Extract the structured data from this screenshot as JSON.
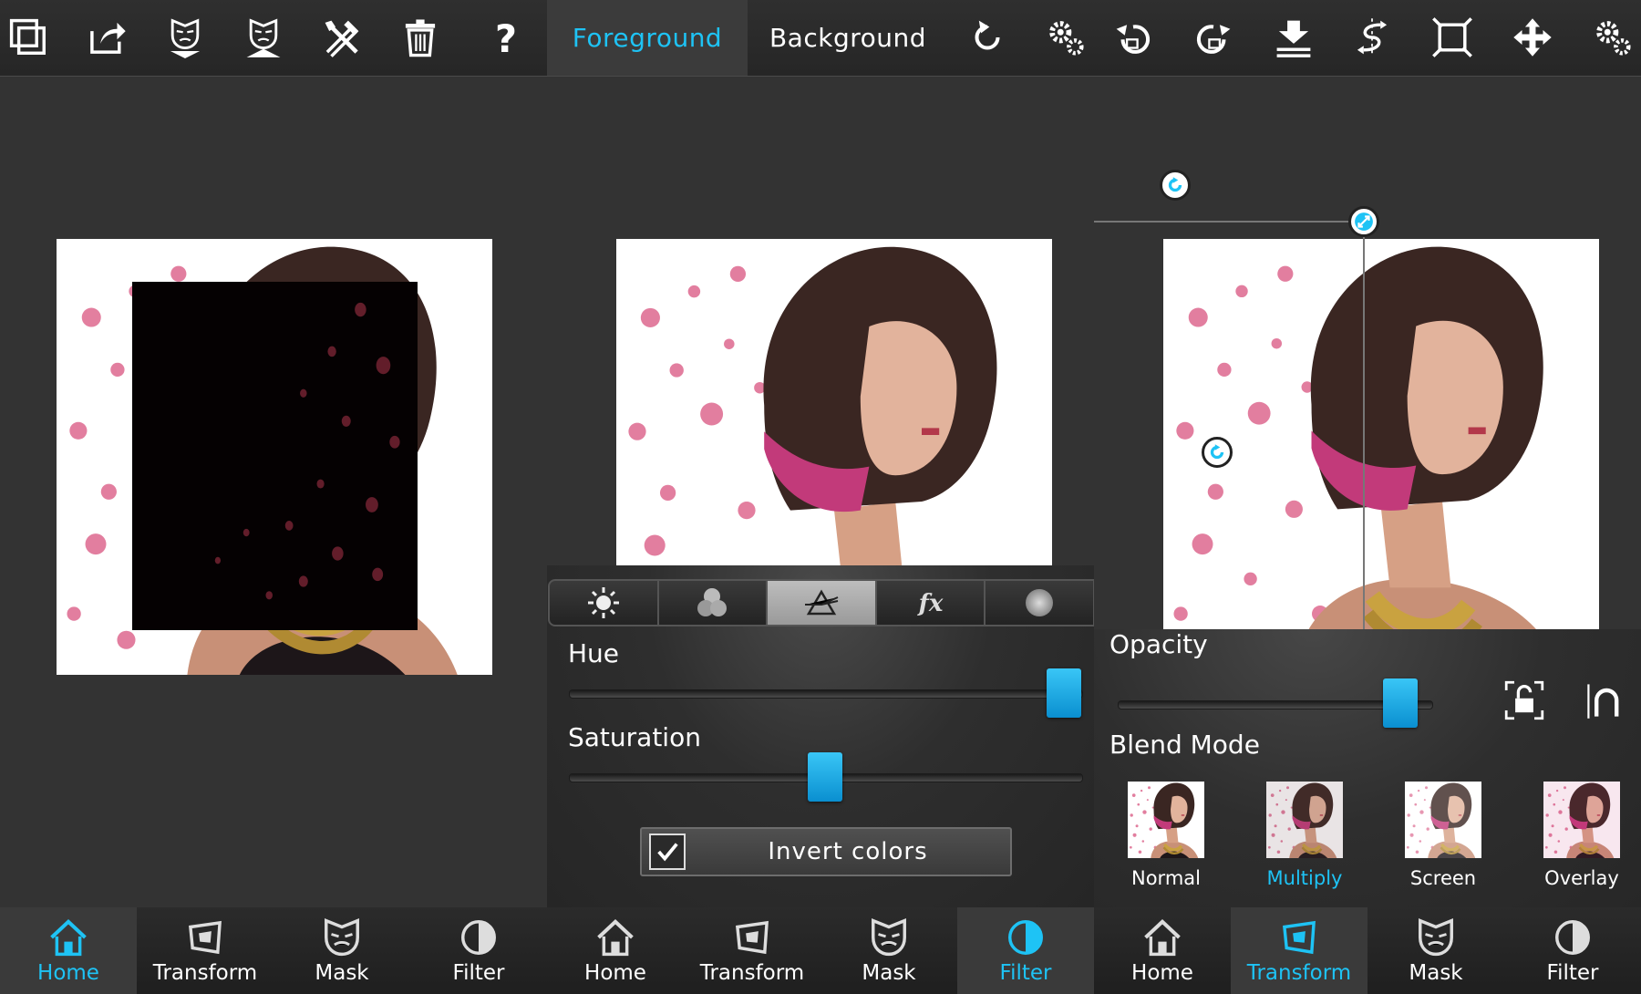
{
  "colors": {
    "accent": "#1ec3f5",
    "background": "#333333",
    "toolbar": "#2b2b2b",
    "slider_thumb": "#1aa9e6"
  },
  "toolbar": {
    "left_icons": [
      "layers-icon",
      "share-icon",
      "mask-down-icon",
      "mask-up-icon",
      "tools-icon",
      "trash-icon",
      "help-icon"
    ],
    "tabs": [
      {
        "label": "Foreground",
        "active": true
      },
      {
        "label": "Background",
        "active": false
      }
    ],
    "right_icons": [
      "reset-icon",
      "settings-icon",
      "undo-icon",
      "redo-icon",
      "merge-down-icon",
      "flip-icon",
      "crop-icon",
      "move-icon",
      "settings-2-icon"
    ]
  },
  "filter_panel": {
    "tabs": [
      "brightness-icon",
      "color-balance-icon",
      "hue-prism-icon",
      "fx-icon",
      "vignette-icon"
    ],
    "active_tab": 2,
    "sliders": [
      {
        "label": "Hue",
        "value": 1.0
      },
      {
        "label": "Saturation",
        "value": 0.5
      }
    ],
    "invert": {
      "label": "Invert colors",
      "checked": true
    }
  },
  "blend_panel": {
    "opacity_label": "Opacity",
    "opacity_value": 0.95,
    "blend_label": "Blend Mode",
    "modes": [
      {
        "label": "Normal",
        "active": false
      },
      {
        "label": "Multiply",
        "active": true
      },
      {
        "label": "Screen",
        "active": false
      },
      {
        "label": "Overlay",
        "active": false
      }
    ]
  },
  "bottom_nav": {
    "panel1": [
      {
        "label": "Home",
        "icon": "home-icon",
        "active": true
      },
      {
        "label": "Transform",
        "icon": "transform-icon",
        "active": false
      },
      {
        "label": "Mask",
        "icon": "mask-icon",
        "active": false
      },
      {
        "label": "Filter",
        "icon": "filter-icon",
        "active": false
      }
    ],
    "panel2": [
      {
        "label": "Home",
        "icon": "home-icon",
        "active": false
      },
      {
        "label": "Transform",
        "icon": "transform-icon",
        "active": false
      },
      {
        "label": "Mask",
        "icon": "mask-icon",
        "active": false
      },
      {
        "label": "Filter",
        "icon": "filter-icon",
        "active": true
      }
    ],
    "panel3": [
      {
        "label": "Home",
        "icon": "home-icon",
        "active": false
      },
      {
        "label": "Transform",
        "icon": "transform-icon",
        "active": true
      },
      {
        "label": "Mask",
        "icon": "mask-icon",
        "active": false
      },
      {
        "label": "Filter",
        "icon": "filter-icon",
        "active": false
      }
    ]
  }
}
